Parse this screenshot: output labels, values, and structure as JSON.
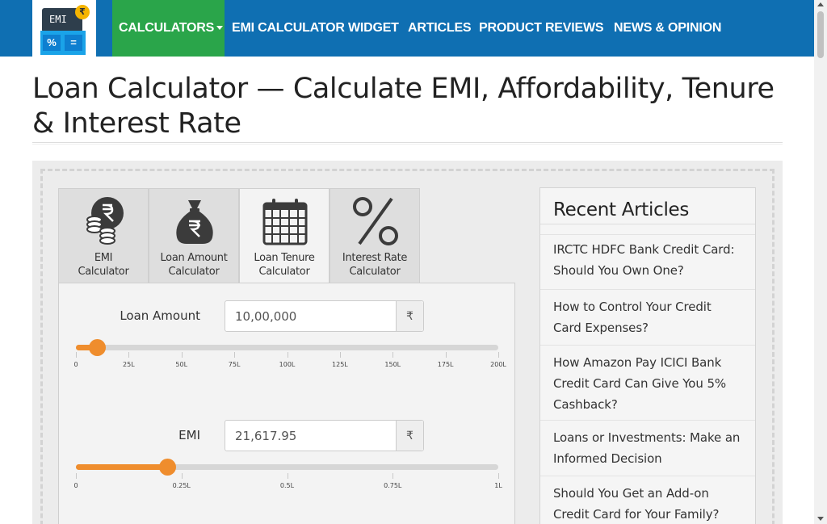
{
  "logo": {
    "screen_text": "EMI",
    "coin_symbol": "₹",
    "key_left": "%",
    "key_right": "="
  },
  "nav": {
    "items": [
      {
        "label": "CALCULATORS",
        "active": true
      },
      {
        "label": "EMI CALCULATOR WIDGET"
      },
      {
        "label": "ARTICLES"
      },
      {
        "label": "PRODUCT REVIEWS"
      },
      {
        "label": "NEWS & OPINION"
      }
    ],
    "active_color": "#2aa54a",
    "bar_color": "#0f6fb2"
  },
  "page_title": "Loan Calculator — Calculate EMI, Affordability, Tenure & Interest Rate",
  "tabs": [
    {
      "label_line1": "EMI",
      "label_line2": "Calculator",
      "icon": "coins-icon"
    },
    {
      "label_line1": "Loan Amount",
      "label_line2": "Calculator",
      "icon": "money-bag-icon"
    },
    {
      "label_line1": "Loan Tenure",
      "label_line2": "Calculator",
      "icon": "calendar-icon",
      "active": true
    },
    {
      "label_line1": "Interest Rate",
      "label_line2": "Calculator",
      "icon": "percent-icon"
    }
  ],
  "calculator": {
    "loan_amount": {
      "label": "Loan Amount",
      "value": "10,00,000",
      "unit": "₹",
      "slider_fraction": 0.05,
      "ticks": [
        "0",
        "25L",
        "50L",
        "75L",
        "100L",
        "125L",
        "150L",
        "175L",
        "200L"
      ]
    },
    "emi": {
      "label": "EMI",
      "value": "21,617.95",
      "unit": "₹",
      "slider_fraction": 0.216,
      "ticks": [
        "0",
        "0.25L",
        "0.5L",
        "0.75L",
        "1L"
      ]
    },
    "accent_color": "#ef8d2d"
  },
  "sidebar": {
    "title": "Recent Articles",
    "articles": [
      "IRCTC HDFC Bank Credit Card: Should You Own One?",
      "How to Control Your Credit Card Expenses?",
      "How Amazon Pay ICICI Bank Credit Card Can Give You 5% Cashback?",
      "Loans or Investments: Make an Informed Decision",
      "Should You Get an Add-on Credit Card for Your Family?"
    ]
  }
}
